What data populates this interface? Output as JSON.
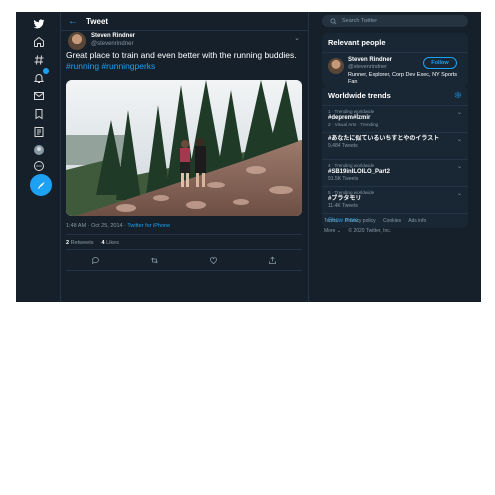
{
  "header": {
    "title": "Tweet"
  },
  "tweet": {
    "author_name": "Steven Rindner",
    "author_handle": "@stevenrindner",
    "text_main": "Great place to train and even better with the running buddies.",
    "hashtags": "#running #runningperks",
    "time": "1:48 AM · Oct 25, 2014",
    "source": "Twitter for iPhone",
    "retweets_count": "2",
    "retweets_label": "Retweets",
    "likes_count": "4",
    "likes_label": "Likes"
  },
  "search": {
    "placeholder": "Search Twitter"
  },
  "relevant_people": {
    "title": "Relevant people",
    "name": "Steven Rindner",
    "handle": "@stevenrindner",
    "bio": "Runner, Explorer, Corp Dev Exec, NY Sports Fan",
    "follow_label": "Follow"
  },
  "trends": {
    "title": "Worldwide trends",
    "items": [
      {
        "context": "1 · Trending worldwide",
        "name": "#deprem#İzmir",
        "extra": "",
        "count": ""
      },
      {
        "context": "2 · Visual Arts · Trending",
        "name": "#あなたに似ているいちすとやのイラスト",
        "extra": "",
        "count": "9,484 Tweets"
      },
      {
        "context": "4 · Trending worldwide",
        "name": "#SB19inILOILO_Part2",
        "extra": "",
        "count": "91.5K Tweets"
      },
      {
        "context": "5 · Trending worldwide",
        "name": "#ブラタモリ",
        "extra": "",
        "count": "11.4K Tweets"
      }
    ],
    "show_more": "Show more"
  },
  "footer": {
    "links": [
      "Terms",
      "Privacy policy",
      "Cookies",
      "Ads info"
    ],
    "more": "More ⌄",
    "copyright": "© 2020 Twitter, Inc."
  },
  "colors": {
    "background": "#15202b",
    "accent": "#1da1f2",
    "card": "#192734"
  }
}
